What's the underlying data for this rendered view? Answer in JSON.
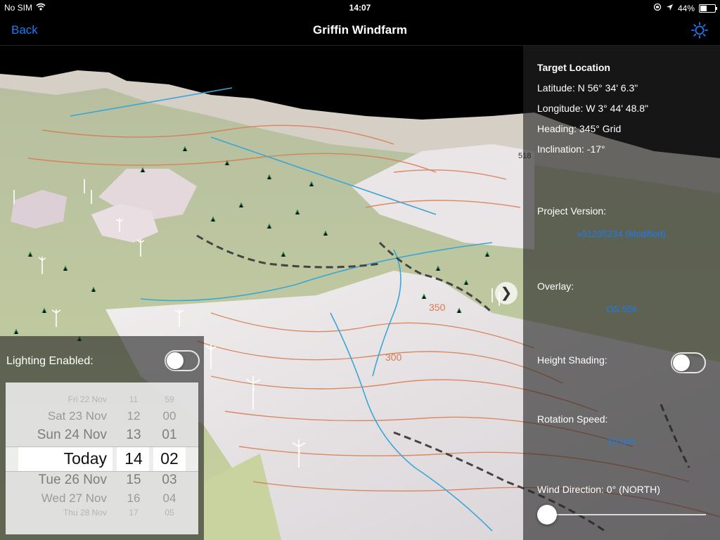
{
  "status_bar": {
    "carrier": "No SIM",
    "time": "14:07",
    "battery": "44%",
    "battery_level": 0.44
  },
  "nav": {
    "back_label": "Back",
    "title": "Griffin Windfarm",
    "settings_icon": "sun-gear-icon"
  },
  "info_panel": {
    "target_heading": "Target Location",
    "latitude": "Latitude: N 56° 34' 6.3\"",
    "longitude": "Longitude: W 3° 44' 48.8\"",
    "heading": "Heading: 345° Grid",
    "inclination": "Inclination: -17°",
    "project_version_label": "Project Version:",
    "project_version_value": "v31235234 (Modified)",
    "overlay_label": "Overlay:",
    "overlay_value": "OS 50k",
    "height_shading_label": "Height Shading:",
    "height_shading_on": false,
    "rotation_speed_label": "Rotation Speed:",
    "rotation_speed_value": "10 rpm",
    "wind_direction_label": "Wind Direction: 0° (NORTH)",
    "wind_direction_value": 0
  },
  "lighting_panel": {
    "label": "Lighting Enabled:",
    "enabled": false,
    "picker": {
      "rows_above": [
        {
          "day": "Fri 22 Nov",
          "hour": "11",
          "minute": "59"
        },
        {
          "day": "Sat 23 Nov",
          "hour": "12",
          "minute": "00"
        },
        {
          "day": "Sun 24 Nov",
          "hour": "13",
          "minute": "01"
        }
      ],
      "selected": {
        "day": "Today",
        "hour": "14",
        "minute": "02"
      },
      "rows_below": [
        {
          "day": "Tue 26 Nov",
          "hour": "15",
          "minute": "03"
        },
        {
          "day": "Wed 27 Nov",
          "hour": "16",
          "minute": "04"
        },
        {
          "day": "Thu 28 Nov",
          "hour": "17",
          "minute": "05"
        }
      ]
    }
  },
  "map": {
    "expand_icon": "chevron-right-icon",
    "colors": {
      "sky": "#000000",
      "terrain": "#c9d3a5",
      "moor": "#ebe6e6",
      "contour": "#d9794f",
      "water": "#3aa6d6",
      "track": "#444444"
    },
    "labels": {
      "contour_a": "350",
      "contour_b": "300",
      "spot_height": "518"
    }
  }
}
